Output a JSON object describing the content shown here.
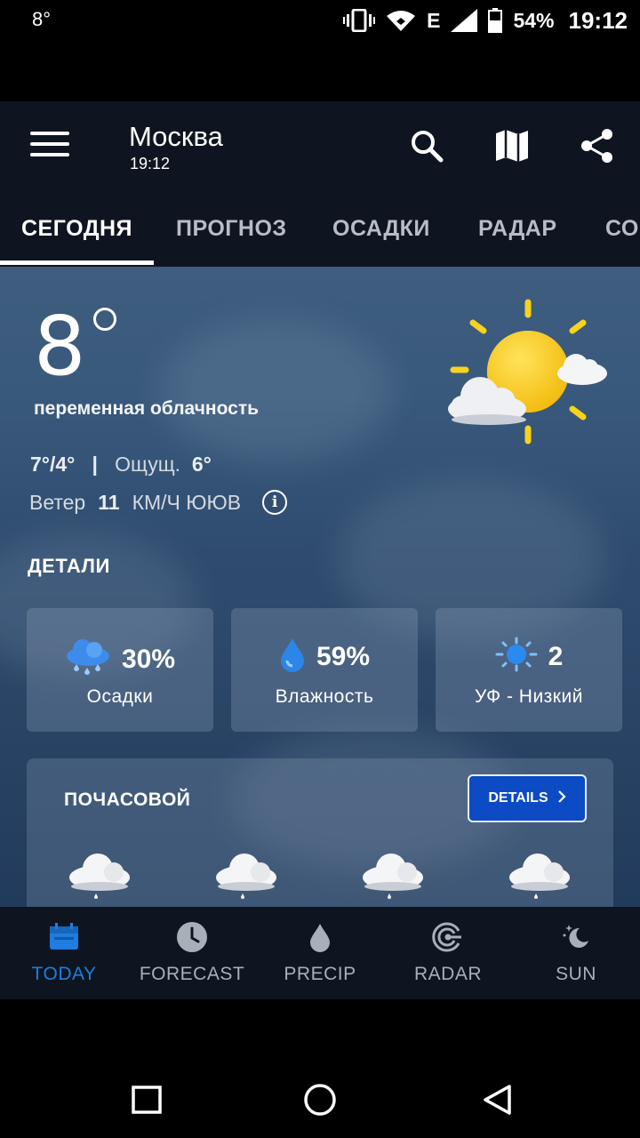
{
  "status_bar": {
    "left_temp": "8°",
    "network_type": "E",
    "battery": "54%",
    "time": "19:12"
  },
  "header": {
    "location": "Москва",
    "time": "19:12",
    "icons": [
      "menu-icon",
      "search-icon",
      "map-icon",
      "share-icon"
    ]
  },
  "tabs": [
    {
      "label": "СЕГОДНЯ",
      "active": true
    },
    {
      "label": "ПРОГНОЗ",
      "active": false
    },
    {
      "label": "ОСАДКИ",
      "active": false
    },
    {
      "label": "РАДАР",
      "active": false
    },
    {
      "label": "СО",
      "active": false
    }
  ],
  "current": {
    "temperature": "8",
    "condition": "переменная облачность",
    "high_low": "7°/4°",
    "separator": "|",
    "feels_like_label": "Ощущ.",
    "feels_like_value": "6°",
    "wind_label": "Ветер",
    "wind_speed": "11",
    "wind_unit_dir": "КМ/Ч ЮЮВ",
    "weather_icon": "partly-cloudy-sun-icon"
  },
  "details": {
    "title": "ДЕТАЛИ",
    "cards": [
      {
        "value": "30%",
        "label": "Осадки",
        "icon": "rain-cloud-icon"
      },
      {
        "value": "59%",
        "label": "Влажность",
        "icon": "droplet-icon"
      },
      {
        "value": "2",
        "label": "УФ - Низкий",
        "icon": "sun-icon"
      }
    ]
  },
  "hourly": {
    "title": "ПОЧАСОВОЙ",
    "button_label": "DETAILS",
    "icons": [
      "rain-cloud-icon",
      "rain-cloud-icon",
      "rain-cloud-icon",
      "rain-cloud-icon"
    ]
  },
  "bottom_nav": [
    {
      "label": "TODAY",
      "icon": "calendar-icon",
      "active": true
    },
    {
      "label": "FORECAST",
      "icon": "clock-icon",
      "active": false
    },
    {
      "label": "PRECIP",
      "icon": "droplet-icon",
      "active": false
    },
    {
      "label": "RADAR",
      "icon": "radar-icon",
      "active": false
    },
    {
      "label": "SUN",
      "icon": "moon-star-icon",
      "active": false
    }
  ],
  "colors": {
    "accent": "#1e7de0",
    "button": "#0c4bc4",
    "appbar": "#0f1520"
  }
}
